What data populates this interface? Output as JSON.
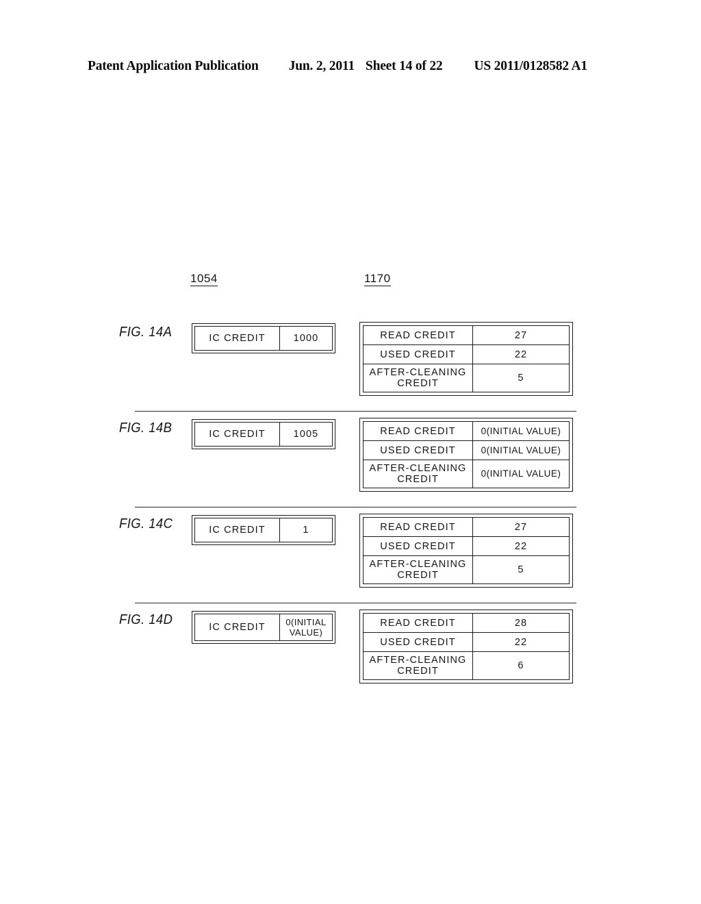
{
  "header": {
    "publication": "Patent Application Publication",
    "date": "Jun. 2, 2011",
    "sheet": "Sheet 14 of 22",
    "patent_number": "US 2011/0128582 A1"
  },
  "refs": {
    "left": "1054",
    "right": "1170"
  },
  "figures": [
    {
      "label": "FIG. 14A",
      "ic_box": {
        "name": "IC CREDIT",
        "value": "1000",
        "two_line": false
      },
      "table": {
        "rows": [
          {
            "name": "READ CREDIT",
            "value": "27",
            "initial": false
          },
          {
            "name": "USED CREDIT",
            "value": "22",
            "initial": false
          },
          {
            "name": "AFTER-CLEANING CREDIT",
            "value": "5",
            "initial": false
          }
        ]
      }
    },
    {
      "label": "FIG. 14B",
      "ic_box": {
        "name": "IC CREDIT",
        "value": "1005",
        "two_line": false
      },
      "table": {
        "rows": [
          {
            "name": "READ CREDIT",
            "value": "0(INITIAL VALUE)",
            "initial": true
          },
          {
            "name": "USED CREDIT",
            "value": "0(INITIAL VALUE)",
            "initial": true
          },
          {
            "name": "AFTER-CLEANING CREDIT",
            "value": "0(INITIAL VALUE)",
            "initial": true
          }
        ]
      }
    },
    {
      "label": "FIG. 14C",
      "ic_box": {
        "name": "IC CREDIT",
        "value": "1",
        "two_line": false
      },
      "table": {
        "rows": [
          {
            "name": "READ CREDIT",
            "value": "27",
            "initial": false
          },
          {
            "name": "USED CREDIT",
            "value": "22",
            "initial": false
          },
          {
            "name": "AFTER-CLEANING CREDIT",
            "value": "5",
            "initial": false
          }
        ]
      }
    },
    {
      "label": "FIG. 14D",
      "ic_box": {
        "name": "IC CREDIT",
        "value": "0(INITIAL VALUE)",
        "two_line": true
      },
      "table": {
        "rows": [
          {
            "name": "READ CREDIT",
            "value": "28",
            "initial": false
          },
          {
            "name": "USED CREDIT",
            "value": "22",
            "initial": false
          },
          {
            "name": "AFTER-CLEANING CREDIT",
            "value": "6",
            "initial": false
          }
        ]
      }
    }
  ]
}
